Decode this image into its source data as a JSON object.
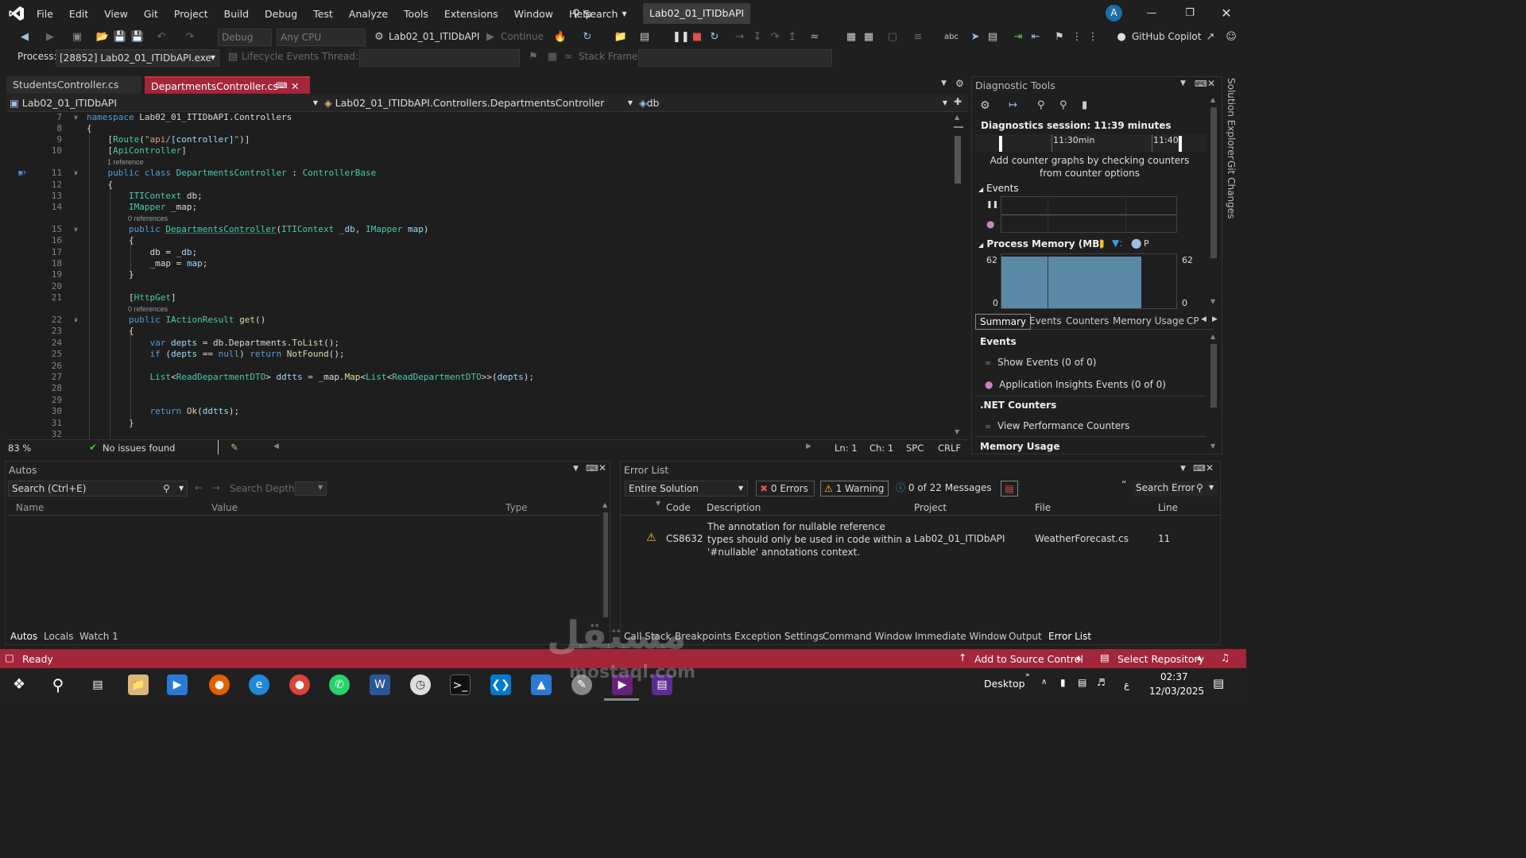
{
  "app": {
    "menu": [
      "File",
      "Edit",
      "View",
      "Git",
      "Project",
      "Build",
      "Debug",
      "Test",
      "Analyze",
      "Tools",
      "Extensions",
      "Window",
      "Help"
    ],
    "search_label": "Search",
    "solution_title": "Lab02_01_ITIDbAPI",
    "avatar_initial": "A"
  },
  "toolbar": {
    "config": "Debug",
    "platform": "Any CPU",
    "startup_project": "Lab02_01_ITIDbAPI",
    "continue_label": "Continue",
    "copilot_label": "GitHub Copilot"
  },
  "debug_bar": {
    "process_label": "Process:",
    "process_value": "[28852] Lab02_01_ITIDbAPI.exe",
    "lifecycle_label": "Lifecycle Events",
    "thread_label": "Thread:",
    "stack_frame_label": "Stack Frame:"
  },
  "tabs": [
    {
      "label": "StudentsController.cs",
      "active": false
    },
    {
      "label": "DepartmentsController.cs",
      "active": true
    }
  ],
  "navbar": {
    "project": "Lab02_01_ITIDbAPI",
    "type": "Lab02_01_ITIDbAPI.Controllers.DepartmentsController",
    "member": "db"
  },
  "code": {
    "ref1": "1 reference",
    "ref0a": "0 references",
    "ref0b": "0 references"
  },
  "editor_status": {
    "zoom": "83 %",
    "issues": "No issues found",
    "ln": "Ln: 1",
    "ch": "Ch: 1",
    "spc": "SPC",
    "crlf": "CRLF"
  },
  "diagnostics": {
    "title": "Diagnostic Tools",
    "session": "Diagnostics session: 11:39 minutes",
    "time_1": "11:30min",
    "time_2": "11:40",
    "add_counter_hint": "Add counter graphs by checking counters from counter options",
    "events_heading": "Events",
    "memory_heading": "Process Memory (MB)",
    "memory_legend_p": "P",
    "memory_max": "62",
    "memory_min": "0",
    "memory_level_fraction": 0.95,
    "tabs": [
      "Summary",
      "Events",
      "Counters",
      "Memory Usage",
      "CP"
    ],
    "section_events": "Events",
    "show_events": "Show Events (0 of 0)",
    "app_insights": "Application Insights Events (0 of 0)",
    "net_counters": ".NET Counters",
    "view_perf": "View Performance Counters",
    "memory_usage": "Memory Usage"
  },
  "right_rail": [
    "Solution Explorer",
    "Git Changes"
  ],
  "autos": {
    "title": "Autos",
    "search_placeholder": "Search (Ctrl+E)",
    "search_depth": "Search Depth:",
    "col_name": "Name",
    "col_value": "Value",
    "col_type": "Type",
    "bottom_tabs": [
      "Autos",
      "Locals",
      "Watch 1"
    ]
  },
  "error_list": {
    "title": "Error List",
    "scope": "Entire Solution",
    "errors": "0 Errors",
    "warnings": "1 Warning",
    "messages": "0 of 22 Messages",
    "search": "Search Error",
    "cols": [
      "Code",
      "Description",
      "Project",
      "File",
      "Line"
    ],
    "row": {
      "code": "CS8632",
      "description": "The annotation for nullable reference types should only be used in code within a '#nullable' annotations context.",
      "project": "Lab02_01_ITIDbAPI",
      "file": "WeatherForecast.cs",
      "line": "11"
    },
    "bottom_tabs": [
      "Call Stack",
      "Breakpoints",
      "Exception Settings",
      "Command Window",
      "Immediate Window",
      "Output",
      "Error List"
    ]
  },
  "statusbar": {
    "ready": "Ready",
    "source_control": "Add to Source Control",
    "repo": "Select Repository"
  },
  "taskbar": {
    "desktop": "Desktop",
    "lang": "ع",
    "time": "02:37",
    "date": "12/03/2025"
  },
  "watermark": {
    "arabic": "مستقل",
    "latin": "mostaql.com"
  },
  "colors": {
    "status_bar": "#a3263b",
    "accent": "#0078d4"
  }
}
